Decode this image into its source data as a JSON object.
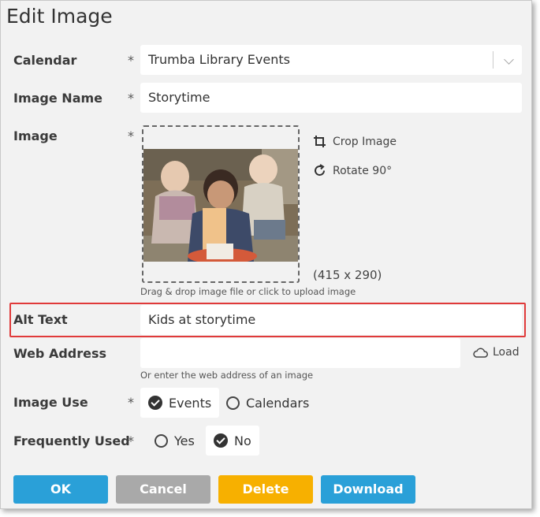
{
  "dialog": {
    "title": "Edit Image"
  },
  "required_marker": "*",
  "calendar": {
    "label": "Calendar",
    "value": "Trumba Library Events"
  },
  "image_name": {
    "label": "Image Name",
    "value": "Storytime"
  },
  "image": {
    "label": "Image",
    "crop_label": "Crop Image",
    "rotate_label": "Rotate 90°",
    "dimensions": "(415 x 290)",
    "upload_hint": "Drag & drop image file or click to upload image"
  },
  "alt_text": {
    "label": "Alt Text",
    "value": "Kids at storytime"
  },
  "web_address": {
    "label": "Web Address",
    "value": "",
    "hint": "Or enter the web address of an image",
    "load_label": "Load"
  },
  "image_use": {
    "label": "Image Use",
    "options": [
      {
        "label": "Events",
        "selected": true
      },
      {
        "label": "Calendars",
        "selected": false
      }
    ]
  },
  "frequently_used": {
    "label": "Frequently Used",
    "options": [
      {
        "label": "Yes",
        "selected": false
      },
      {
        "label": "No",
        "selected": true
      }
    ]
  },
  "buttons": {
    "ok": "OK",
    "cancel": "Cancel",
    "delete": "Delete",
    "download": "Download"
  },
  "colors": {
    "ok": "#2aa0d8",
    "cancel": "#a9a9a9",
    "delete": "#f7b000",
    "download": "#2aa0d8",
    "highlight": "#e03a3a"
  }
}
